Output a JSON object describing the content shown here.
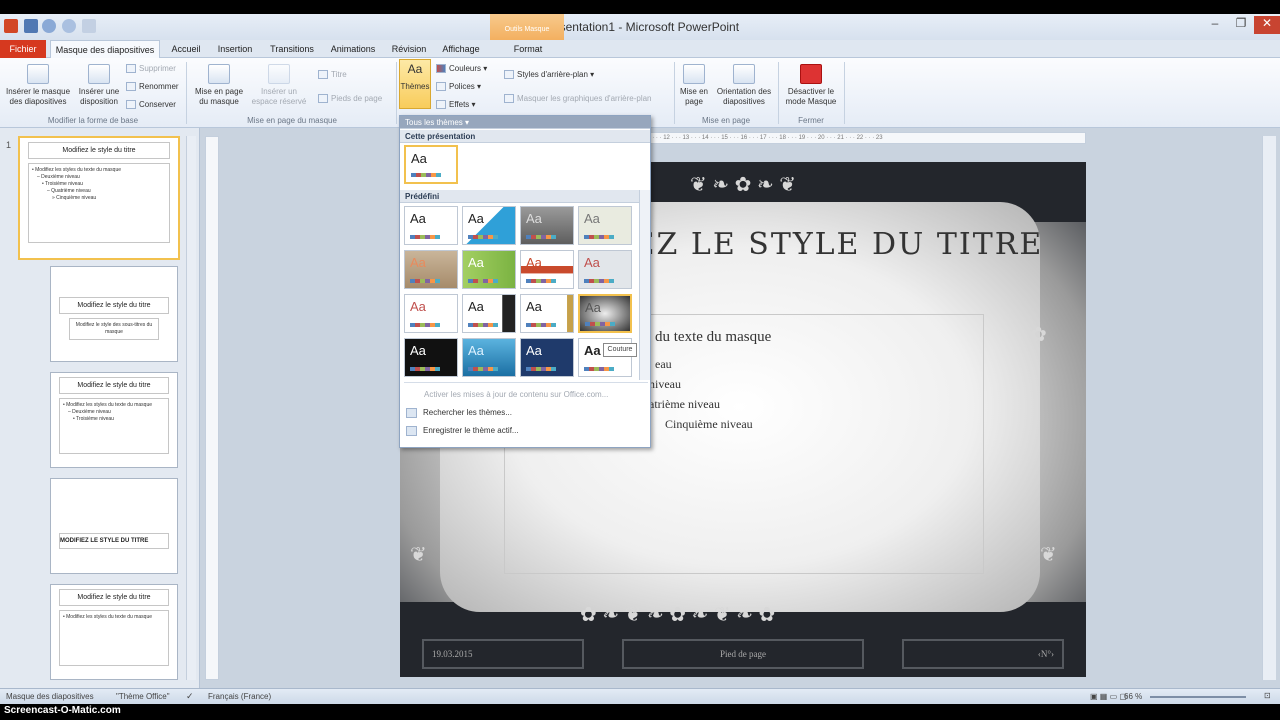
{
  "window": {
    "title": "Présentation1  -  Microsoft PowerPoint",
    "context_tab_title": "Outils Masque",
    "controls": [
      "–",
      "❐",
      "✕"
    ]
  },
  "tabs": [
    {
      "label": "Fichier"
    },
    {
      "label": "Masque des diapositives"
    },
    {
      "label": "Accueil"
    },
    {
      "label": "Insertion"
    },
    {
      "label": "Transitions"
    },
    {
      "label": "Animations"
    },
    {
      "label": "Révision"
    },
    {
      "label": "Affichage"
    },
    {
      "label": "Format"
    }
  ],
  "ribbon": {
    "insert_master": "Insérer le masque des diapositives",
    "insert_layout": "Insérer une disposition",
    "delete": "Supprimer",
    "rename": "Renommer",
    "preserve": "Conserver",
    "group_edit_master": "Modifier la forme de base",
    "master_layout": "Mise en page du masque",
    "insert_placeholder": "Insérer un espace réservé",
    "title_check": "Titre",
    "footers_check": "Pieds de page",
    "group_master_layout": "Mise en page du masque",
    "themes": "Thèmes",
    "colors": "Couleurs",
    "fonts": "Polices",
    "effects": "Effets",
    "background_styles": "Styles d'arrière-plan",
    "hide_background": "Masquer les graphiques d'arrière-plan",
    "page_setup": "Mise en page",
    "slide_orientation": "Orientation des diapositives",
    "group_page_setup": "Mise en page",
    "close_master": "Désactiver le mode Masque",
    "group_close": "Fermer"
  },
  "gallery": {
    "header": "Tous les thèmes",
    "section_current": "Cette présentation",
    "section_builtin": "Prédéfini",
    "tile_text": "Aa",
    "menu_enable_updates": "Activer les mises à jour de contenu sur Office.com...",
    "menu_browse": "Rechercher les thèmes...",
    "menu_save": "Enregistrer le thème actif...",
    "tooltip": "Couture"
  },
  "thumbnails": {
    "first_number": "1",
    "title": "Modifiez le style du titre",
    "body": "• Modifiez les styles du texte du masque",
    "level2": "– Deuxième niveau",
    "level3": "• Troisième niveau",
    "level4": "– Quatrième niveau",
    "level5": "» Cinquième niveau",
    "sub_placeholder": "Modifiez le style des sous-titres du masque",
    "title_caps": "MODIFIEZ LE STYLE DU TITRE"
  },
  "slide": {
    "title": "MODIFIEZ LE STYLE DU TITRE",
    "body_level1": "du texte du masque",
    "body_level2": "eau",
    "body_level3": "niveau",
    "body_level4": "atrième niveau",
    "body_level5": "Cinquième niveau",
    "footer_date": "19.03.2015",
    "footer_center": "Pied de page",
    "footer_number": "‹N°›"
  },
  "status": {
    "view": "Masque des diapositives",
    "theme": "\"Thème Office\"",
    "language": "Français (France)",
    "zoom": "66 %"
  },
  "ruler_text": "4 · · · 3 · · · 2 · · · 1 · · · 0 · · · 1 · · · 2 · · · 3 · · · 4 · · · 5 · · · 6 · · · 7 · · · 8 · · · 9 · · · 10 · · · 11 · · · 12 · · · 13 · · · 14 · · · 15 · · · 16 · · · 17 · · · 18 · · · 19 · · · 20 · · · 21 · · · 22 · · · 23",
  "watermark": "Screencast-O-Matic.com",
  "colors": {
    "accent_file": "#d6391f",
    "context_tab": "#f3b060",
    "theme_selected": "#f2c14e"
  }
}
